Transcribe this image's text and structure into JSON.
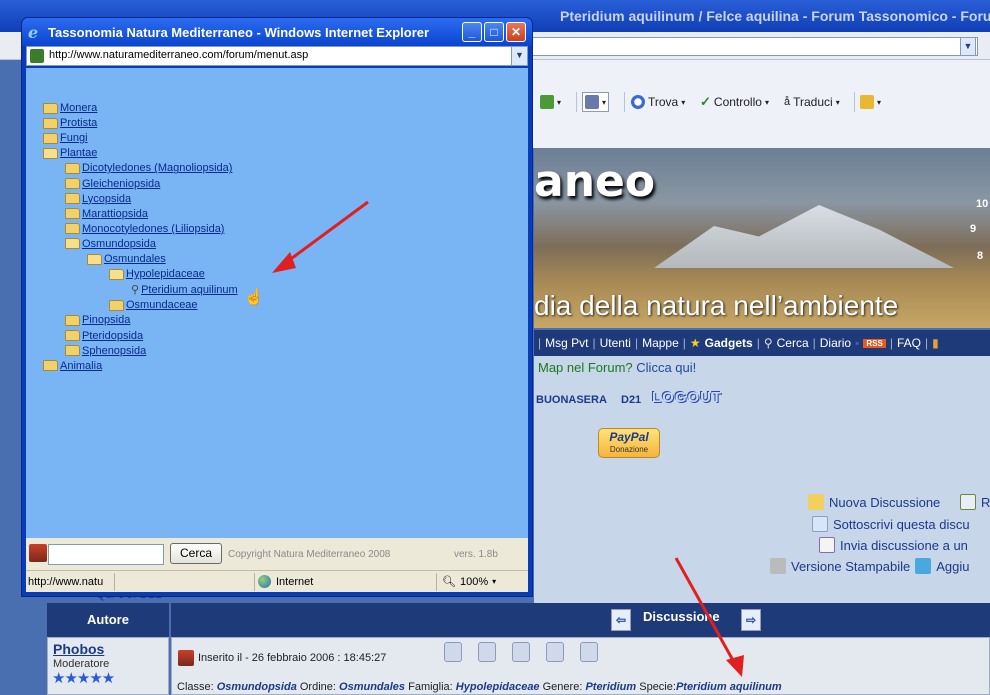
{
  "background_window": {
    "title": "Pteridium aquilinum / Felce aquilina - Forum Tassonomico - Forum Nat - Windows Internet Explorer",
    "toolbar": {
      "trova": "Trova",
      "controllo": "Controllo",
      "traduci": "Traduci"
    },
    "banner": {
      "title": "aneo",
      "subtitle": "dia della natura nell’ambiente",
      "clock": [
        "10",
        "9",
        "8"
      ]
    },
    "menu": {
      "items": [
        "Msg Pvt",
        "Utenti",
        "Mappe",
        "Gadgets",
        "Cerca",
        "Diario",
        "RSS",
        "FAQ"
      ]
    },
    "map_line": {
      "text": "Map nel Forum?",
      "link": "Clicca qui!"
    },
    "greeting": "BUONASERA",
    "username": "D21",
    "logout": "LOGOUT",
    "paypal": {
      "brand": "PayPal",
      "label": "Donazione"
    },
    "actions": {
      "new_discussion": "Nuova Discussione",
      "new_reply_fragment": "R",
      "subscribe": "Sottoscrivi questa discu",
      "send_discussion": "Invia discussione a un",
      "print_version": "Versione Stampabile",
      "add_fragment": "Aggiu"
    },
    "partial_link": "Qui c'è: D21",
    "table": {
      "header_author": "Autore",
      "header_discussion": "Discussione",
      "poster": "Phobos",
      "role": "Moderatore",
      "stars": "★★★★★",
      "posted": "Inserito il - 26 febbraio 2006 : 18:45:27",
      "classification": {
        "classe_label": "Classe:",
        "classe": "Osmundopsida",
        "ordine_label": "Ordine:",
        "ordine": "Osmundales",
        "famiglia_label": "Famiglia:",
        "famiglia": "Hypolepidaceae",
        "genere_label": "Genere:",
        "genere": "Pteridium",
        "specie_label": "Specie:",
        "specie": "Pteridium aquilinum"
      }
    }
  },
  "popup": {
    "title": "Tassonomia Natura Mediterraneo - Windows Internet Explorer",
    "address": "http://www.naturamediterraneo.com/forum/menut.asp",
    "tree": [
      {
        "label": "Monera",
        "level": 0
      },
      {
        "label": "Protista",
        "level": 0
      },
      {
        "label": "Fungi",
        "level": 0
      },
      {
        "label": "Plantae",
        "level": 0
      },
      {
        "label": "Dicotyledones (Magnoliopsida)",
        "level": 1
      },
      {
        "label": "Gleicheniopsida",
        "level": 1
      },
      {
        "label": "Lycopsida",
        "level": 1
      },
      {
        "label": "Marattiopsida",
        "level": 1
      },
      {
        "label": "Monocotyledones (Liliopsida)",
        "level": 1
      },
      {
        "label": "Osmundopsida",
        "level": 1
      },
      {
        "label": "Osmundales",
        "level": 2
      },
      {
        "label": "Hypolepidaceae",
        "level": 3
      },
      {
        "label": "Pteridium aquilinum",
        "level": 4
      },
      {
        "label": "Osmundaceae",
        "level": 3
      },
      {
        "label": "Pinopsida",
        "level": 1
      },
      {
        "label": "Pteridopsida",
        "level": 1
      },
      {
        "label": "Sphenopsida",
        "level": 1
      },
      {
        "label": "Animalia",
        "level": 0
      }
    ],
    "search_button": "Cerca",
    "copyright": "Copyright Natura Mediterraneo 2008",
    "version": "vers. 1.8b",
    "status": {
      "url": "http://www.natu",
      "zone": "Internet",
      "zoom": "100%"
    }
  }
}
